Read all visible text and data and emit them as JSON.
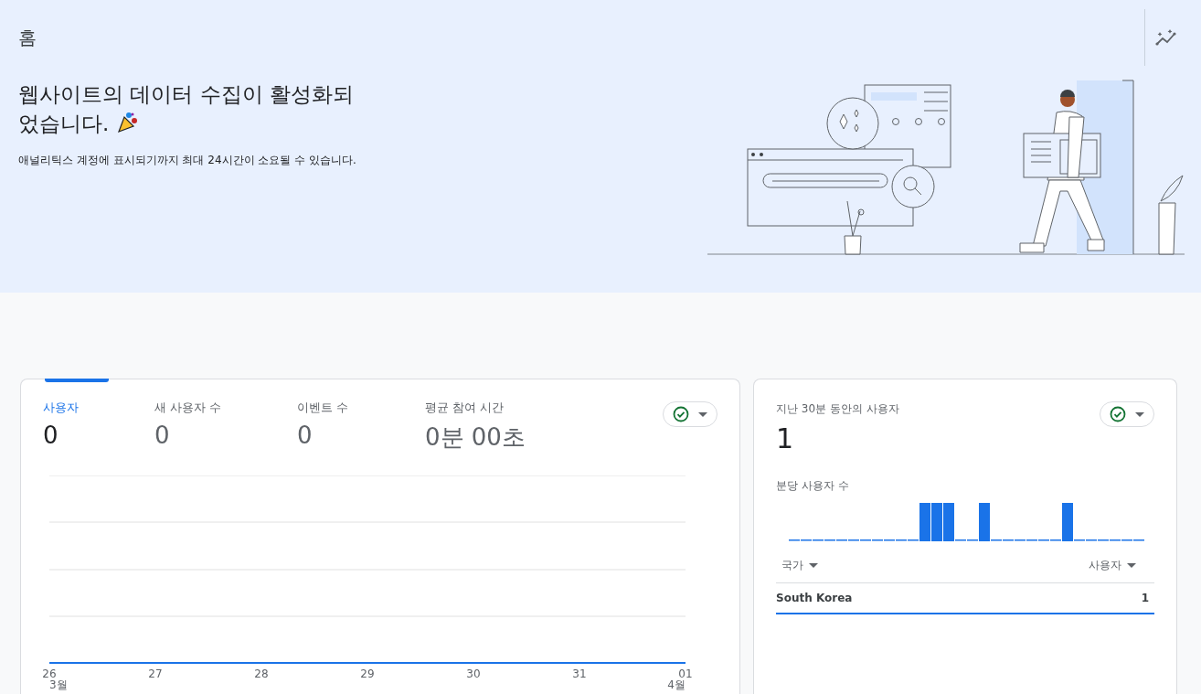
{
  "page": {
    "title": "홈"
  },
  "banner": {
    "headline": "웹사이트의 데이터 수집이 활성화되었습니다.",
    "subtitle": "애널리틱스 계정에 표시되기까지 최대 24시간이 소요될 수 있습니다."
  },
  "overview_card": {
    "metrics": [
      {
        "label": "사용자",
        "value": "0",
        "selected": true
      },
      {
        "label": "새 사용자 수",
        "value": "0",
        "selected": false
      },
      {
        "label": "이벤트 수",
        "value": "0",
        "selected": false
      },
      {
        "label": "평균 참여 시간",
        "value": "0분 00초",
        "selected": false
      }
    ],
    "x_labels": [
      "26",
      "27",
      "28",
      "29",
      "30",
      "31",
      "01"
    ],
    "month_labels": [
      "3월",
      "4월"
    ]
  },
  "realtime_card": {
    "title": "지난 30분 동안의 사용자",
    "value": "1",
    "subtitle": "분당 사용자 수",
    "table": {
      "columns": [
        "국가",
        "사용자"
      ],
      "rows": [
        {
          "country": "South Korea",
          "users": "1"
        }
      ]
    }
  }
}
